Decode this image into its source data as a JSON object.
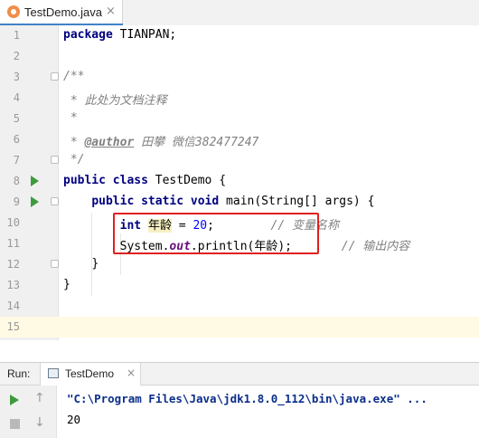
{
  "editor_tab": {
    "label": "TestDemo.java",
    "close": "×"
  },
  "code": {
    "line_numbers": [
      "1",
      "2",
      "3",
      "4",
      "5",
      "6",
      "7",
      "8",
      "9",
      "10",
      "11",
      "12",
      "13",
      "14",
      "15"
    ],
    "l1_kw": "package",
    "l1_rest": " TIANPAN;",
    "l3": "/**",
    "l4": " * 此处为文档注释",
    "l5": " *",
    "l6_pre": " * ",
    "l6_tag": "@author",
    "l6_rest": " 田攀 微信382477247",
    "l7": " */",
    "l8_kw1": "public",
    "l8_kw2": "class",
    "l8_rest": " TestDemo {",
    "l9_kw1": "public",
    "l9_kw2": "static",
    "l9_kw3": "void",
    "l9_rest": " main(String[] args) {",
    "l10_kw": "int",
    "l10_var": "年龄",
    "l10_eq": " = ",
    "l10_num": "20",
    "l10_semi": ";",
    "l10_comment": "// 变量名称",
    "l11_pre": "System.",
    "l11_field": "out",
    "l11_rest": ".println(年龄);",
    "l11_comment": "// 输出内容",
    "l12": "}",
    "l13": "}"
  },
  "run_panel": {
    "label": "Run:",
    "tab_label": "TestDemo",
    "tab_close": "×",
    "up_arrow": "↑",
    "down_arrow": "↓",
    "command": "\"C:\\Program Files\\Java\\jdk1.8.0_112\\bin\\java.exe\" ...",
    "output": "20"
  },
  "icons": {
    "tab": "java-class-icon",
    "run_gutter": "run-icon",
    "rerun": "rerun-icon",
    "stop": "stop-icon"
  },
  "colors": {
    "keyword": "#000080",
    "comment": "#808080",
    "number": "#0000ff",
    "static_field": "#660e7a",
    "run_green": "#3d9b3d",
    "highlight_box": "#e02020",
    "current_line": "#fffae3"
  }
}
